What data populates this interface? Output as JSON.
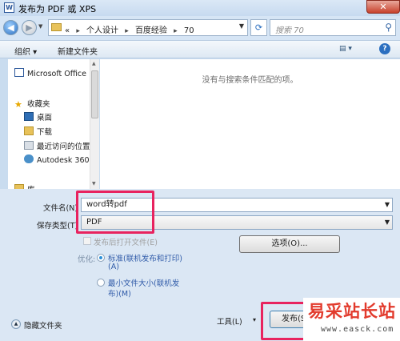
{
  "window": {
    "title": "发布为 PDF 或 XPS",
    "app_icon_letter": "W"
  },
  "address": {
    "prefix": "«",
    "crumbs": [
      "个人设计",
      "百度经验",
      "70"
    ]
  },
  "search": {
    "placeholder": "搜索 70"
  },
  "toolbar": {
    "organize": "组织 ▾",
    "new_folder": "新建文件夹",
    "view": "▾"
  },
  "nav": {
    "items": [
      {
        "label": "Microsoft Office",
        "icon": "word-doc-icon"
      },
      {
        "label": "收藏夹",
        "icon": "star-icon"
      },
      {
        "label": "桌面",
        "icon": "desktop-icon"
      },
      {
        "label": "下载",
        "icon": "download-icon"
      },
      {
        "label": "最近访问的位置",
        "icon": "recent-places-icon"
      },
      {
        "label": "Autodesk 360",
        "icon": "cloud-icon"
      },
      {
        "label": "库",
        "icon": "library-icon"
      }
    ]
  },
  "content": {
    "empty_message": "没有与搜索条件匹配的项。"
  },
  "form": {
    "filename_label": "文件名(N)",
    "filename_value": "word转pdf",
    "savetype_label": "保存类型(T)",
    "savetype_value": "PDF",
    "open_after_label": "发布后打开文件(E)",
    "optimize_label": "优化:",
    "standard_line1": "标准(联机发布和打印)",
    "standard_line2": "(A)",
    "minimum_line1": "最小文件大小(联机发",
    "minimum_line2": "布)(M)",
    "options_button": "选项(O)...",
    "hide_folders": "隐藏文件夹",
    "tools_button": "工具(L)",
    "tools_arrow": "▾",
    "publish_button": "发布(S)"
  },
  "watermark": {
    "title": "易采站长站",
    "url": "www.easck.com"
  },
  "colors": {
    "highlight": "#e8235f",
    "accent": "#2b6fc0",
    "link_text": "#2f5aa8"
  }
}
